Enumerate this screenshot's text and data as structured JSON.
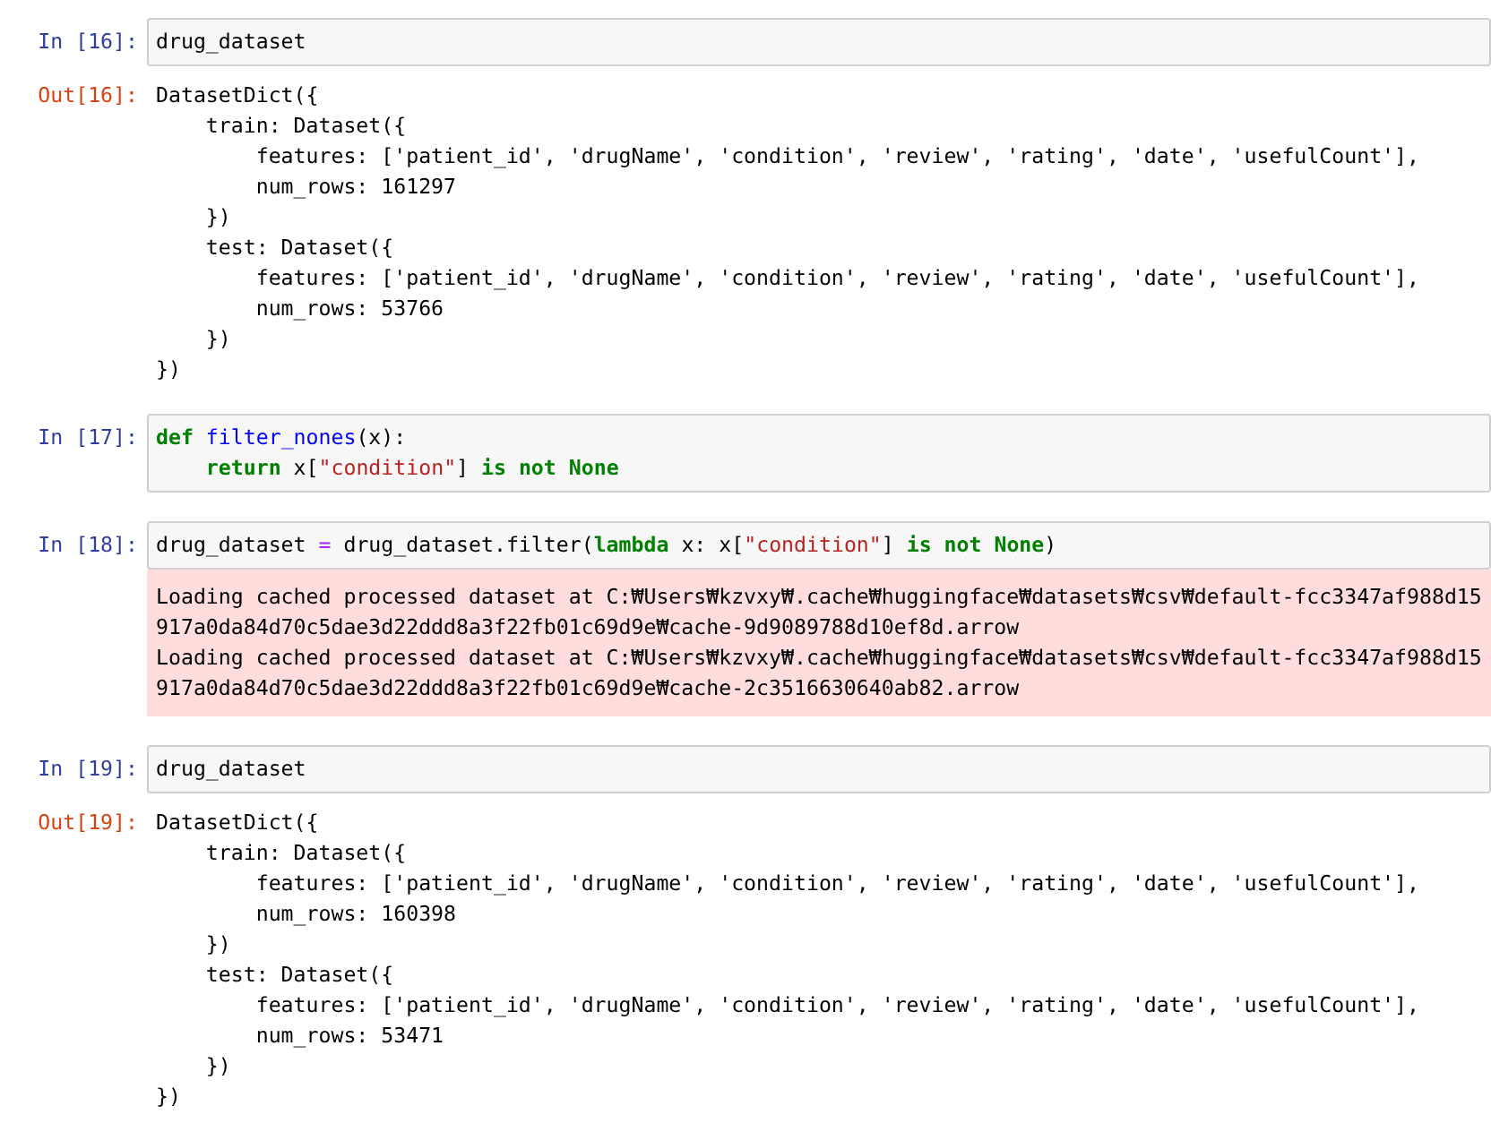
{
  "cells": [
    {
      "prompt": "In [16]:",
      "source": [
        [
          {
            "kind": "name",
            "text": "drug_dataset"
          }
        ]
      ],
      "output": {
        "kind": "result",
        "prompt": "Out[16]:",
        "lines": [
          "DatasetDict({",
          "    train: Dataset({",
          "        features: ['patient_id', 'drugName', 'condition', 'review', 'rating', 'date', 'usefulCount'],",
          "        num_rows: 161297",
          "    })",
          "    test: Dataset({",
          "        features: ['patient_id', 'drugName', 'condition', 'review', 'rating', 'date', 'usefulCount'],",
          "        num_rows: 53766",
          "    })",
          "})"
        ]
      }
    },
    {
      "prompt": "In [17]:",
      "source": [
        [
          {
            "kind": "keyword",
            "text": "def"
          },
          {
            "kind": "defname",
            "text": " filter_nones"
          },
          {
            "kind": "name",
            "text": "(x):"
          }
        ],
        [
          {
            "kind": "keyword",
            "text": "    return"
          },
          {
            "kind": "name",
            "text": " x["
          },
          {
            "kind": "string",
            "text": "\"condition\""
          },
          {
            "kind": "name",
            "text": "] "
          },
          {
            "kind": "keyword",
            "text": "is not None"
          }
        ]
      ]
    },
    {
      "prompt": "In [18]:",
      "source": [
        [
          {
            "kind": "name",
            "text": "drug_dataset "
          },
          {
            "kind": "operator",
            "text": "="
          },
          {
            "kind": "name",
            "text": " drug_dataset.filter("
          },
          {
            "kind": "keyword",
            "text": "lambda"
          },
          {
            "kind": "name",
            "text": " x: x["
          },
          {
            "kind": "string",
            "text": "\"condition\""
          },
          {
            "kind": "name",
            "text": "] "
          },
          {
            "kind": "keyword",
            "text": "is not None"
          },
          {
            "kind": "name",
            "text": ")"
          }
        ]
      ],
      "output": {
        "kind": "stderr",
        "lines": [
          "Loading cached processed dataset at C:₩Users₩kzvxy₩.cache₩huggingface₩datasets₩csv₩default-fcc3347af988d15",
          "917a0da84d70c5dae3d22ddd8a3f22fb01c69d9e₩cache-9d9089788d10ef8d.arrow",
          "Loading cached processed dataset at C:₩Users₩kzvxy₩.cache₩huggingface₩datasets₩csv₩default-fcc3347af988d15",
          "917a0da84d70c5dae3d22ddd8a3f22fb01c69d9e₩cache-2c3516630640ab82.arrow"
        ]
      }
    },
    {
      "prompt": "In [19]:",
      "source": [
        [
          {
            "kind": "name",
            "text": "drug_dataset"
          }
        ]
      ],
      "output": {
        "kind": "result",
        "prompt": "Out[19]:",
        "lines": [
          "DatasetDict({",
          "    train: Dataset({",
          "        features: ['patient_id', 'drugName', 'condition', 'review', 'rating', 'date', 'usefulCount'],",
          "        num_rows: 160398",
          "    })",
          "    test: Dataset({",
          "        features: ['patient_id', 'drugName', 'condition', 'review', 'rating', 'date', 'usefulCount'],",
          "        num_rows: 53471",
          "    })",
          "})"
        ]
      }
    }
  ]
}
